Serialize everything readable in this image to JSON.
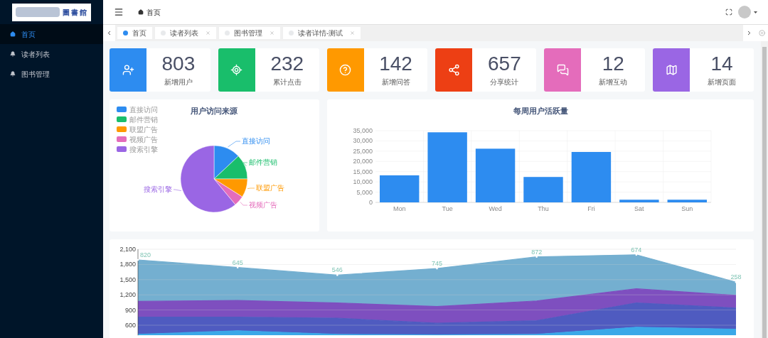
{
  "logo": {
    "text": "圖書館"
  },
  "sidebar": {
    "items": [
      {
        "label": "首页",
        "selected": true
      },
      {
        "label": "读者列表",
        "selected": false
      },
      {
        "label": "图书管理",
        "selected": false
      }
    ]
  },
  "header": {
    "breadcrumb": "首页"
  },
  "tabs": [
    {
      "label": "首页",
      "selected": true,
      "closable": false
    },
    {
      "label": "读者列表",
      "selected": false,
      "closable": true
    },
    {
      "label": "图书管理",
      "selected": false,
      "closable": true
    },
    {
      "label": "读者详情-测试",
      "selected": false,
      "closable": true
    }
  ],
  "stats": [
    {
      "value": "803",
      "label": "新增用户",
      "color": "#2d8cf0"
    },
    {
      "value": "232",
      "label": "累计点击",
      "color": "#19be6b"
    },
    {
      "value": "142",
      "label": "新增问答",
      "color": "#ff9900"
    },
    {
      "value": "657",
      "label": "分享统计",
      "color": "#ed3f14"
    },
    {
      "value": "12",
      "label": "新增互动",
      "color": "#e46cbb"
    },
    {
      "value": "14",
      "label": "新增页面",
      "color": "#9a66e4"
    }
  ],
  "pie": {
    "legend": [
      {
        "label": "直接访问",
        "color": "#2d8cf0"
      },
      {
        "label": "邮件营销",
        "color": "#19be6b"
      },
      {
        "label": "联盟广告",
        "color": "#ff9900"
      },
      {
        "label": "视频广告",
        "color": "#e46cbb"
      },
      {
        "label": "搜索引擎",
        "color": "#9a66e4"
      }
    ],
    "chart_data": {
      "type": "pie",
      "title": "用户访问来源",
      "categories": [
        "直接访问",
        "邮件营销",
        "联盟广告",
        "视频广告",
        "搜索引擎"
      ],
      "values": [
        13,
        12,
        9,
        5,
        61
      ]
    }
  },
  "bar": {
    "chart_data": {
      "type": "bar",
      "title": "每周用户活跃量",
      "grid": true,
      "categories": [
        "Mon",
        "Tue",
        "Wed",
        "Thu",
        "Fri",
        "Sat",
        "Sun"
      ],
      "series": [
        {
          "color": "#2d8cf0",
          "values": [
            13200,
            34200,
            26200,
            12400,
            24600,
            1300,
            1300
          ]
        }
      ],
      "ylim": [
        0,
        35000
      ],
      "yticks": [
        {
          "value": 0,
          "label": "0"
        },
        {
          "value": 5000,
          "label": "5,000"
        },
        {
          "value": 10000,
          "label": "10,000"
        },
        {
          "value": 15000,
          "label": "15,000"
        },
        {
          "value": 20000,
          "label": "20,000"
        },
        {
          "value": 25000,
          "label": "25,000"
        },
        {
          "value": 30000,
          "label": "30,000"
        },
        {
          "value": 35000,
          "label": "35,000"
        }
      ]
    }
  },
  "area": {
    "chart_data": {
      "type": "area",
      "grid": true,
      "ylim": [
        400,
        2100
      ],
      "yticks": [
        {
          "value": 600,
          "label": "600"
        },
        {
          "value": 900,
          "label": "900"
        },
        {
          "value": 1200,
          "label": "1,200"
        },
        {
          "value": 1500,
          "label": "1,500"
        },
        {
          "value": 1800,
          "label": "1,800"
        },
        {
          "value": 2100,
          "label": "2,100"
        }
      ],
      "series": [
        {
          "color": "#3aa8e8",
          "values": [
            420,
            490,
            420,
            410,
            420,
            560,
            520
          ]
        },
        {
          "color": "#4f5bc0",
          "values": [
            760,
            760,
            740,
            640,
            690,
            1040,
            940
          ]
        },
        {
          "color": "#7e4fbf",
          "values": [
            1070,
            1090,
            1040,
            970,
            1080,
            1320,
            1190
          ]
        },
        {
          "color": "#74afd0",
          "values": [
            1890,
            1740,
            1590,
            1720,
            1950,
            1990,
            1450
          ]
        }
      ],
      "value_labels": [
        "820",
        "645",
        "546",
        "745",
        "872",
        "674",
        "258"
      ]
    }
  }
}
